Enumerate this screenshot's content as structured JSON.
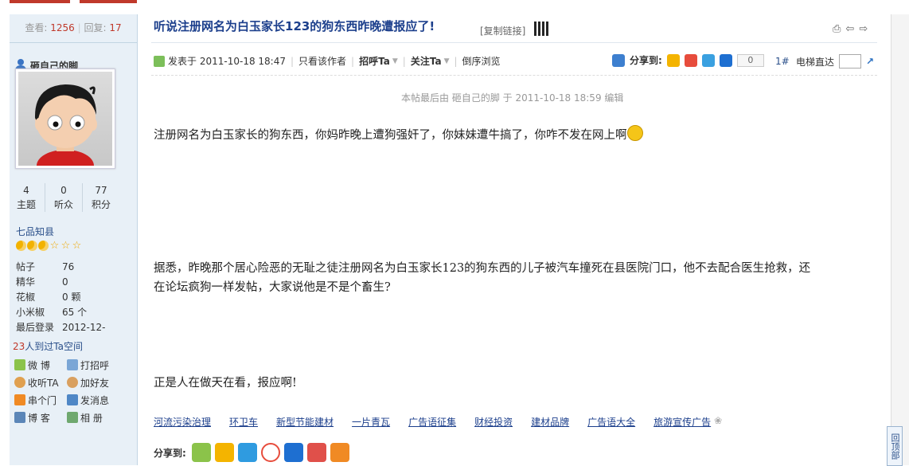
{
  "sidebar": {
    "stats": {
      "views_label": "查看:",
      "views": "1256",
      "replies_label": "回复:",
      "replies": "17"
    },
    "author_name": "砸自己的脚",
    "counts": [
      {
        "value": "4",
        "label": "主题"
      },
      {
        "value": "0",
        "label": "听众"
      },
      {
        "value": "77",
        "label": "积分"
      }
    ],
    "rank": "七品知县",
    "info": [
      {
        "key": "帖子",
        "value": "76"
      },
      {
        "key": "精华",
        "value": "0"
      },
      {
        "key": "花椒",
        "value": "0 颗"
      },
      {
        "key": "小米椒",
        "value": "65 个"
      },
      {
        "key": "最后登录",
        "value": "2012-12-"
      }
    ],
    "visited_count": "23",
    "visited_text": "人到过Ta空间",
    "actions": [
      {
        "label": "微 博",
        "icon": "weibo-icon"
      },
      {
        "label": "打招呼",
        "icon": "greet-icon"
      },
      {
        "label": "收听TA",
        "icon": "follow-icon"
      },
      {
        "label": "加好友",
        "icon": "add-friend-icon"
      },
      {
        "label": "串个门",
        "icon": "home-icon"
      },
      {
        "label": "发消息",
        "icon": "message-icon"
      },
      {
        "label": "博 客",
        "icon": "blog-icon"
      },
      {
        "label": "相 册",
        "icon": "album-icon"
      }
    ]
  },
  "post": {
    "title": "听说注册网名为白玉家长123的狗东西昨晚遭报应了!",
    "copy_link": "[复制链接]",
    "meta": {
      "posted_prefix": "发表于",
      "posted_time": "2011-10-18 18:47",
      "only_author": "只看该作者",
      "greet": "招呼Ta",
      "follow": "关注Ta",
      "reverse": "倒序浏览"
    },
    "share_label": "分享到:",
    "share_count": "0",
    "floor": "1#",
    "elevator": "电梯直达",
    "edited": "本帖最后由 砸自己的脚 于 2011-10-18 18:59 编辑",
    "paragraphs": [
      "注册网名为白玉家长的狗东西，你妈昨晚上遭狗强奸了，你妹妹遭牛搞了，你咋不发在网上啊",
      "据悉，昨晚那个居心险恶的无耻之徒注册网名为白玉家长123的狗东西的儿子被汽车撞死在县医院门口，他不去配合医生抢救，还",
      "在论坛疯狗一样发帖，大家说他是不是个畜生?",
      "正是人在做天在看，报应啊!"
    ],
    "tags": [
      "河流污染治理",
      "环卫车",
      "新型节能建材",
      "一片青瓦",
      "广告语征集",
      "财经投资",
      "建材品牌",
      "广告语大全",
      "旅游宣传广告"
    ],
    "share_bottom_label": "分享到:"
  },
  "back_to_top": "回顶部"
}
